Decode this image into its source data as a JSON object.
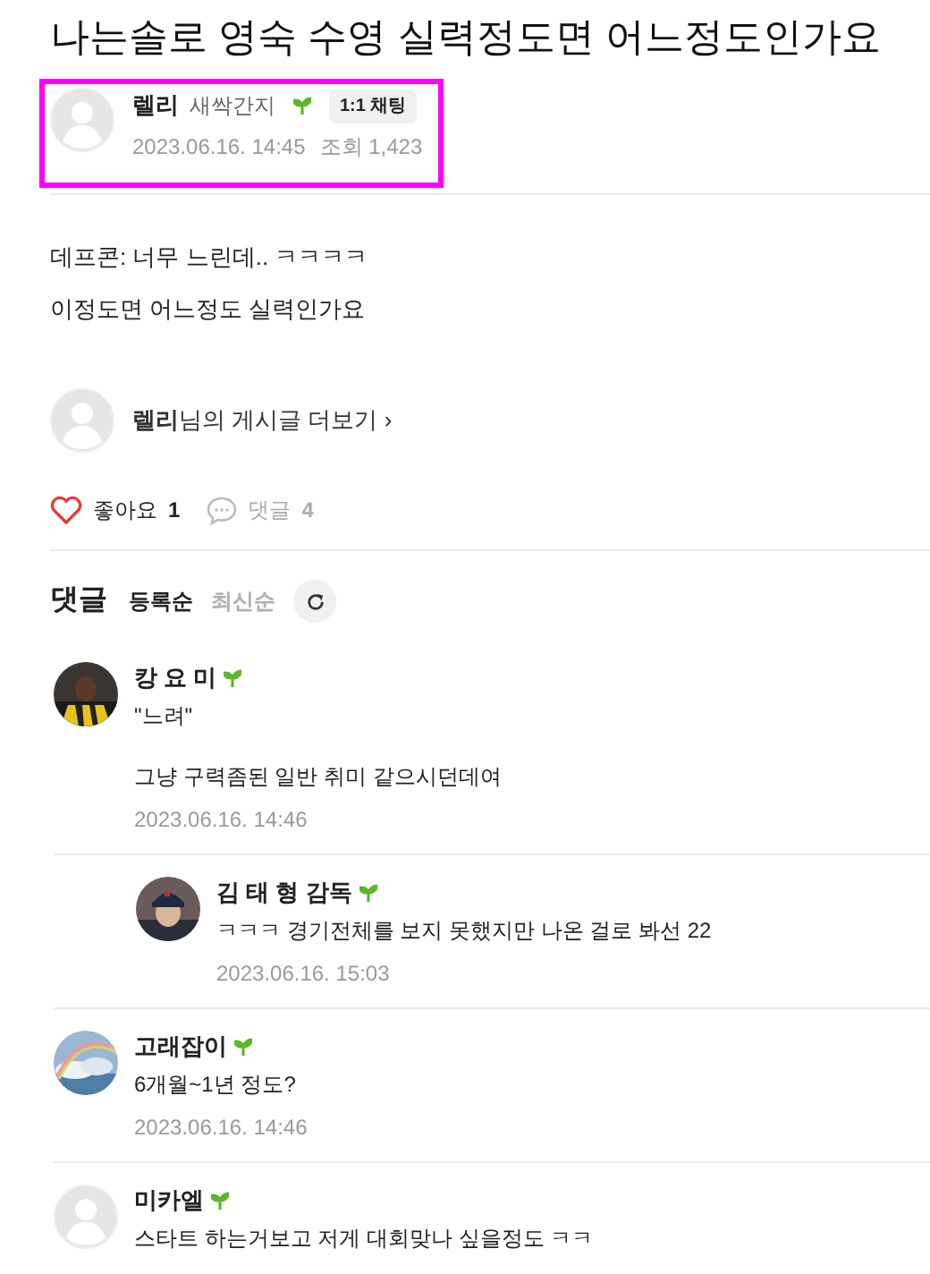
{
  "title": "나는솔로 영숙 수영 실력정도면 어느정도인가요",
  "author": {
    "name": "렐리",
    "level": "새싹간지",
    "chat_button": "1:1 채팅",
    "date": "2023.06.16. 14:45",
    "views": "조회 1,423",
    "highlighted": true
  },
  "body": [
    "데프콘: 너무 느린데.. ㅋㅋㅋㅋ",
    "이정도면 어느정도 실력인가요"
  ],
  "more_posts": {
    "name": "렐리",
    "suffix": "님의 게시글 더보기",
    "arrow": "›"
  },
  "actions": {
    "like_label": "좋아요",
    "like_count": "1",
    "liked": true,
    "comment_label": "댓글",
    "comment_count": "4"
  },
  "comments_header": {
    "title": "댓글",
    "sorts": [
      {
        "label": "등록순",
        "selected": true
      },
      {
        "label": "최신순",
        "selected": false
      }
    ]
  },
  "comments": [
    {
      "kind": "picture",
      "name": "캉 요 미",
      "reply": false,
      "text": "\"느려\"\n\n그냥 구력좀된 일반 취미 같으시던데여",
      "date": "2023.06.16. 14:46"
    },
    {
      "kind": "picture",
      "name": "김 태 형 감독",
      "reply": true,
      "text": "ㅋㅋㅋ 경기전체를 보지 못했지만 나온 걸로 봐선 22",
      "date": "2023.06.16. 15:03"
    },
    {
      "kind": "picture",
      "name": "고래잡이",
      "reply": false,
      "text": "6개월~1년 정도?",
      "date": "2023.06.16. 14:46"
    },
    {
      "kind": "default",
      "name": "미카엘",
      "reply": false,
      "text": "스타트 하는거보고 저게 대회맞나 싶을정도 ㅋㅋ"
    }
  ]
}
